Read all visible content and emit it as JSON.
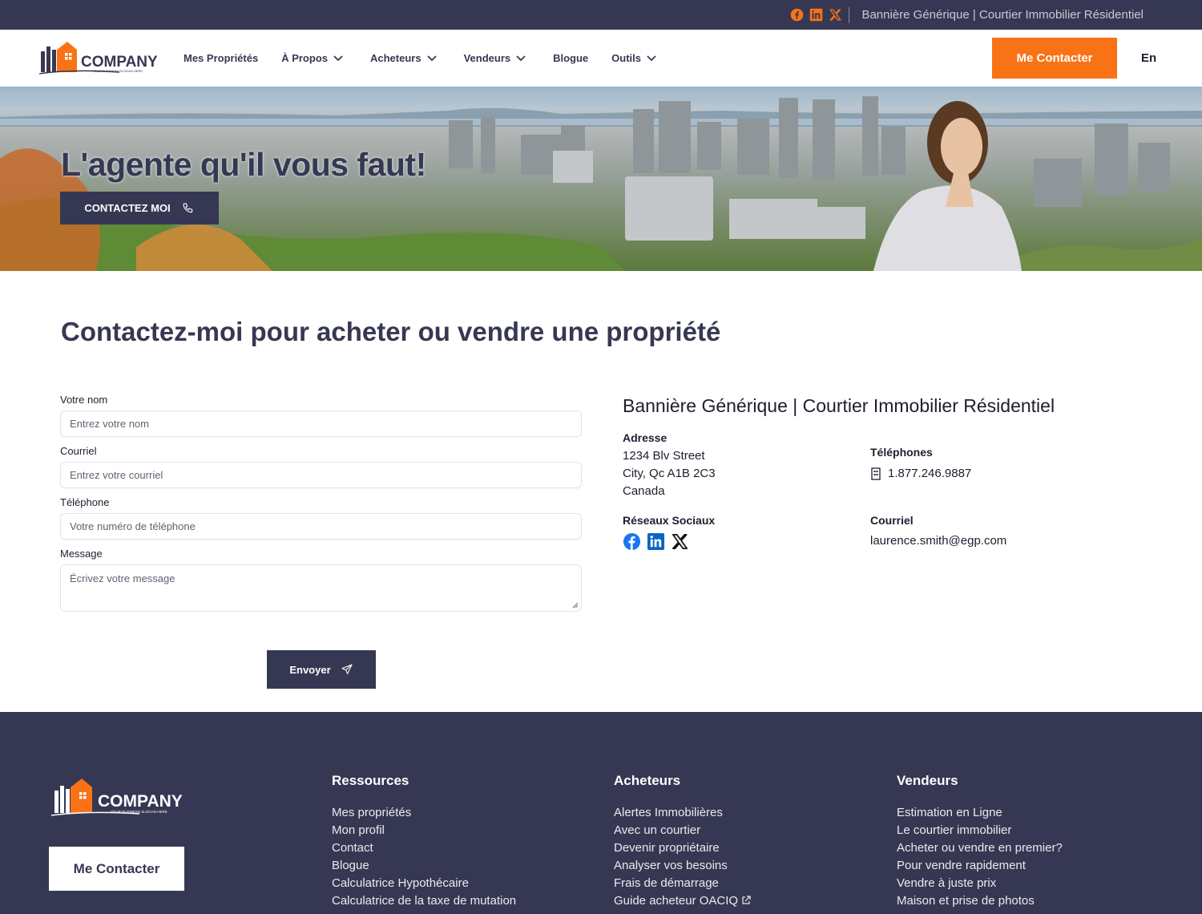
{
  "topbar": {
    "social_icons": [
      "facebook-icon",
      "linkedin-icon",
      "x-icon"
    ],
    "brand": "Bannière Générique | Courtier Immobilier Résidentiel"
  },
  "logo": {
    "name": "COMPANY",
    "slogan": "YOUR BUSINESS SLOGAN HERE"
  },
  "nav": {
    "items": [
      {
        "label": "Mes Propriétés",
        "dropdown": false
      },
      {
        "label": "À Propos",
        "dropdown": true
      },
      {
        "label": "Acheteurs",
        "dropdown": true
      },
      {
        "label": "Vendeurs",
        "dropdown": true
      },
      {
        "label": "Blogue",
        "dropdown": false
      },
      {
        "label": "Outils",
        "dropdown": true
      }
    ],
    "contact_button": "Me Contacter",
    "lang": "En"
  },
  "hero": {
    "title": "L'agente qu'il vous faut!",
    "button": "CONTACTEZ MOI"
  },
  "main": {
    "heading": "Contactez-moi pour acheter ou vendre une propriété",
    "form": {
      "name_label": "Votre nom",
      "name_placeholder": "Entrez votre nom",
      "email_label": "Courriel",
      "email_placeholder": "Entrez votre courriel",
      "phone_label": "Téléphone",
      "phone_placeholder": "Votre numéro de téléphone",
      "message_label": "Message",
      "message_placeholder": "Écrivez votre message",
      "submit": "Envoyer"
    },
    "info": {
      "title": "Bannière Générique | Courtier Immobilier Résidentiel",
      "address_label": "Adresse",
      "address_line1": "1234 Blv Street",
      "address_line2": "City, Qc A1B 2C3",
      "address_line3": "Canada",
      "phones_label": "Téléphones",
      "phone": "1.877.246.9887",
      "social_label": "Réseaux Sociaux",
      "email_label": "Courriel",
      "email": "laurence.smith@egp.com"
    }
  },
  "footer": {
    "contact_button": "Me Contacter",
    "columns": [
      {
        "title": "Ressources",
        "items": [
          "Mes propriétés",
          "Mon profil",
          "Contact",
          "Blogue",
          "Calculatrice Hypothécaire",
          "Calculatrice de la taxe de mutation"
        ]
      },
      {
        "title": "Acheteurs",
        "items": [
          "Alertes Immobilières",
          "Avec un courtier",
          "Devenir propriétaire",
          "Analyser vos besoins",
          "Frais de démarrage",
          "Guide acheteur OACIQ"
        ]
      },
      {
        "title": "Vendeurs",
        "items": [
          "Estimation en Ligne",
          "Le courtier immobilier",
          "Acheter ou vendre en premier?",
          "Pour vendre rapidement",
          "Vendre à juste prix",
          "Maison et prise de photos"
        ]
      }
    ]
  },
  "colors": {
    "navy": "#363853",
    "orange": "#f97316"
  }
}
